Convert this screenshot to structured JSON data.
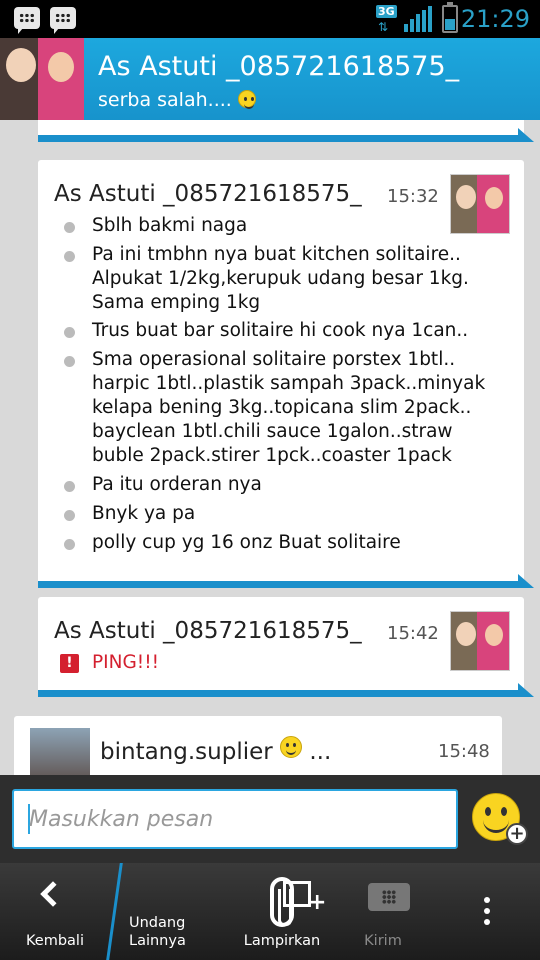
{
  "status_bar": {
    "network": "3G",
    "time": "21:29"
  },
  "header": {
    "contact_name": "As Astuti _085721618575_",
    "contact_status": "serba salah...."
  },
  "bubbles": [
    {
      "sender": "As Astuti _085721618575_",
      "time": "15:32",
      "messages": [
        "Sblh bakmi naga",
        "Pa ini tmbhn nya buat kitchen solitaire.. Alpukat 1/2kg,kerupuk udang besar 1kg. Sama emping 1kg",
        "Trus buat bar solitaire hi cook nya 1can..",
        "Sma operasional solitaire porstex 1btl.. harpic 1btl..plastik sampah 3pack..minyak kelapa bening 3kg..topicana slim 2pack.. bayclean 1btl.chili sauce 1galon..straw buble 2pack.stirer 1pck..coaster 1pack",
        "Pa itu orderan nya",
        "Bnyk ya pa",
        "polly cup yg 16 onz Buat solitaire"
      ]
    },
    {
      "sender": "As Astuti _085721618575_",
      "time": "15:42",
      "ping_text": "PING!!!"
    },
    {
      "sender": "bintang.suplier",
      "sender_suffix": "...",
      "time": "15:48"
    }
  ],
  "input": {
    "placeholder": "Masukkan pesan"
  },
  "toolbar": {
    "back": "Kembali",
    "invite_line1": "Undang",
    "invite_line2": "Lainnya",
    "attach": "Lampirkan",
    "send": "Kirim"
  },
  "colors": {
    "accent": "#1a8fcb",
    "header": "#1da8de",
    "ping": "#d4202f"
  }
}
